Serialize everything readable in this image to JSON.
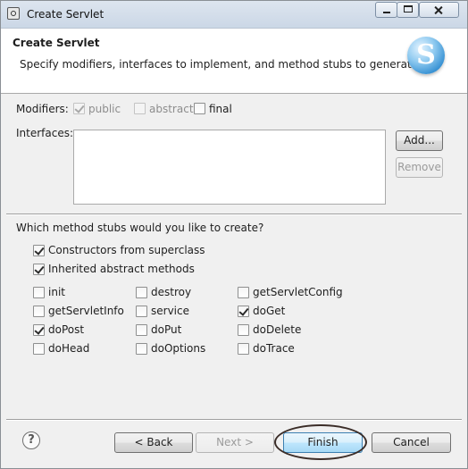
{
  "window": {
    "title": "Create Servlet"
  },
  "header": {
    "title": "Create Servlet",
    "description": "Specify modifiers, interfaces to implement, and method stubs to generate.",
    "badge_letter": "S"
  },
  "modifiers": {
    "label": "Modifiers:",
    "public": {
      "label": "public",
      "checked": true,
      "enabled": false
    },
    "abstract": {
      "label": "abstract",
      "checked": false,
      "enabled": false
    },
    "final": {
      "label": "final",
      "checked": false,
      "enabled": true
    }
  },
  "interfaces": {
    "label": "Interfaces:",
    "items": [],
    "add_label": "Add...",
    "remove_label": "Remove"
  },
  "stubs": {
    "question": "Which method stubs would you like to create?",
    "constructors": {
      "label": "Constructors from superclass",
      "checked": true
    },
    "inherited": {
      "label": "Inherited abstract methods",
      "checked": true
    },
    "grid": [
      {
        "label": "init",
        "checked": false
      },
      {
        "label": "destroy",
        "checked": false
      },
      {
        "label": "getServletConfig",
        "checked": false
      },
      {
        "label": "getServletInfo",
        "checked": false
      },
      {
        "label": "service",
        "checked": false
      },
      {
        "label": "doGet",
        "checked": true
      },
      {
        "label": "doPost",
        "checked": true
      },
      {
        "label": "doPut",
        "checked": false
      },
      {
        "label": "doDelete",
        "checked": false
      },
      {
        "label": "doHead",
        "checked": false
      },
      {
        "label": "doOptions",
        "checked": false
      },
      {
        "label": "doTrace",
        "checked": false
      }
    ]
  },
  "footer": {
    "help_label": "?",
    "back_label": "< Back",
    "next_label": "Next >",
    "finish_label": "Finish",
    "cancel_label": "Cancel"
  }
}
